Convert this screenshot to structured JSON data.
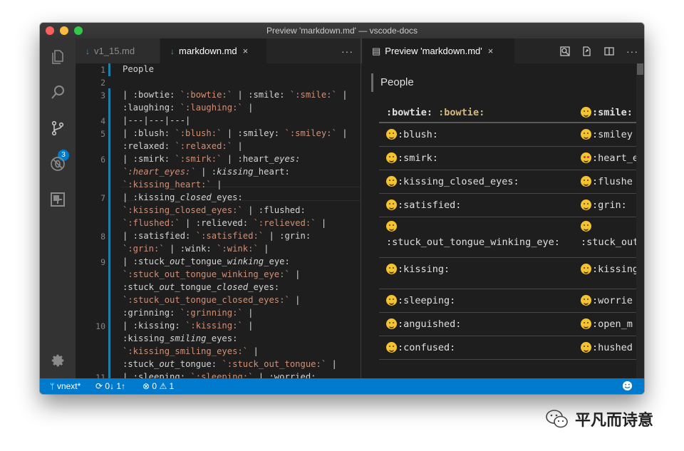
{
  "window": {
    "title": "Preview 'markdown.md' — vscode-docs"
  },
  "activity_bar": {
    "scm_badge": "3"
  },
  "left_editor": {
    "tabs": [
      {
        "label": "v1_15.md",
        "icon": "markdown-file-icon"
      },
      {
        "label": "markdown.md",
        "icon": "markdown-file-icon"
      }
    ],
    "close_glyph": "×",
    "more_glyph": "···",
    "line_numbers": [
      "1",
      "2",
      "3",
      "4",
      "5",
      "6",
      "7",
      "8",
      "9",
      "10",
      "11"
    ],
    "lines": [
      {
        "segs": [
          {
            "t": "People"
          }
        ]
      },
      {
        "segs": [
          {
            "t": "| :bowtie: "
          },
          {
            "t": "`:bowtie:`",
            "c": "s"
          },
          {
            "t": " | :smile: "
          },
          {
            "t": "`:smile:`",
            "c": "s"
          },
          {
            "t": " |"
          }
        ]
      },
      {
        "segs": [
          {
            "t": ":laughing: "
          },
          {
            "t": "`:laughing:`",
            "c": "s"
          },
          {
            "t": " |"
          }
        ]
      },
      {
        "segs": [
          {
            "t": "|---|---|---|"
          }
        ]
      },
      {
        "segs": [
          {
            "t": "| :blush: "
          },
          {
            "t": "`:blush:`",
            "c": "s"
          },
          {
            "t": " | :smiley: "
          },
          {
            "t": "`:smiley:`",
            "c": "s"
          },
          {
            "t": " |"
          }
        ]
      },
      {
        "segs": [
          {
            "t": ":relaxed: "
          },
          {
            "t": "`:relaxed:`",
            "c": "s"
          },
          {
            "t": " |"
          }
        ]
      },
      {
        "segs": [
          {
            "t": "| :smirk: "
          },
          {
            "t": "`:smirk:`",
            "c": "s"
          },
          {
            "t": " | :heart_"
          },
          {
            "t": "eyes:",
            "c": "i"
          }
        ]
      },
      {
        "segs": [
          {
            "t": "`:heart_eyes:`",
            "c": "s i"
          },
          {
            "t": " | :"
          },
          {
            "t": "kissing",
            "c": "i"
          },
          {
            "t": "_heart:"
          }
        ]
      },
      {
        "segs": [
          {
            "t": "`:kissing_heart:`",
            "c": "s"
          },
          {
            "t": " |"
          }
        ]
      },
      {
        "segs": [
          {
            "t": "| :kissing_"
          },
          {
            "t": "closed",
            "c": "i"
          },
          {
            "t": "_eyes:"
          }
        ]
      },
      {
        "segs": [
          {
            "t": "`:kissing_closed_eyes:`",
            "c": "s"
          },
          {
            "t": " | :flushed:"
          }
        ]
      },
      {
        "segs": [
          {
            "t": "`:flushed:`",
            "c": "s"
          },
          {
            "t": " | :relieved: "
          },
          {
            "t": "`:relieved:`",
            "c": "s"
          },
          {
            "t": " |"
          }
        ]
      },
      {
        "segs": [
          {
            "t": "| :satisfied: "
          },
          {
            "t": "`:satisfied:`",
            "c": "s"
          },
          {
            "t": " | :grin:"
          }
        ]
      },
      {
        "segs": [
          {
            "t": "`:grin:`",
            "c": "s"
          },
          {
            "t": " | :wink: "
          },
          {
            "t": "`:wink:`",
            "c": "s"
          },
          {
            "t": " |"
          }
        ]
      },
      {
        "segs": [
          {
            "t": "| :stuck_"
          },
          {
            "t": "out",
            "c": "i"
          },
          {
            "t": "_tongue_"
          },
          {
            "t": "winking",
            "c": "i"
          },
          {
            "t": "_eye:"
          }
        ]
      },
      {
        "segs": [
          {
            "t": "`:stuck_out_tongue_winking_eye:`",
            "c": "s"
          },
          {
            "t": " |"
          }
        ]
      },
      {
        "segs": [
          {
            "t": ":stuck_"
          },
          {
            "t": "out",
            "c": "i"
          },
          {
            "t": "_tongue_"
          },
          {
            "t": "closed",
            "c": "i"
          },
          {
            "t": "_eyes:"
          }
        ]
      },
      {
        "segs": [
          {
            "t": "`:stuck_out_tongue_closed_eyes:`",
            "c": "s"
          },
          {
            "t": " |"
          }
        ]
      },
      {
        "segs": [
          {
            "t": ":grinning: "
          },
          {
            "t": "`:grinning:`",
            "c": "s"
          },
          {
            "t": " |"
          }
        ]
      },
      {
        "segs": [
          {
            "t": "| :kissing: "
          },
          {
            "t": "`:kissing:`",
            "c": "s"
          },
          {
            "t": " |"
          }
        ]
      },
      {
        "segs": [
          {
            "t": ":kissing_"
          },
          {
            "t": "smiling",
            "c": "i"
          },
          {
            "t": "_eyes:"
          }
        ]
      },
      {
        "segs": [
          {
            "t": "`:kissing_smiling_eyes:`",
            "c": "s"
          },
          {
            "t": " |"
          }
        ]
      },
      {
        "segs": [
          {
            "t": ":stuck_"
          },
          {
            "t": "out",
            "c": "i"
          },
          {
            "t": "_tongue: "
          },
          {
            "t": "`:stuck_out_tongue:`",
            "c": "s"
          },
          {
            "t": " |"
          }
        ]
      },
      {
        "segs": [
          {
            "t": "| :sleeping: "
          },
          {
            "t": "`:sleeping:`",
            "c": "s"
          },
          {
            "t": " | :worried:"
          }
        ]
      }
    ]
  },
  "right_editor": {
    "tab": {
      "label": "Preview 'markdown.md'"
    },
    "heading": "People",
    "header_row": {
      "c1_label": ":bowtie:",
      "c1_code": ":bowtie:",
      "c2": ":smile:"
    },
    "rows": [
      {
        "c1": ":blush:",
        "c2": ":smiley"
      },
      {
        "c1": ":smirk:",
        "c2": ":heart_e"
      },
      {
        "c1": ":kissing_closed_eyes:",
        "c2": ":flushe"
      },
      {
        "c1": ":satisfied:",
        "c2": ":grin:"
      },
      {
        "c1": ":stuck_out_tongue_winking_eye:",
        "c2": ":stuck_out"
      },
      {
        "c1": ":kissing:",
        "c2": ":kissing"
      },
      {
        "c1": ":sleeping:",
        "c2": ":worrie"
      },
      {
        "c1": ":anguished:",
        "c2": ":open_m"
      },
      {
        "c1": ":confused:",
        "c2": ":hushed"
      }
    ]
  },
  "status_bar": {
    "branch": "vnext*",
    "sync": "0↓ 1↑",
    "errors": "0",
    "warnings": "1"
  },
  "watermark": {
    "text": "平凡而诗意"
  }
}
